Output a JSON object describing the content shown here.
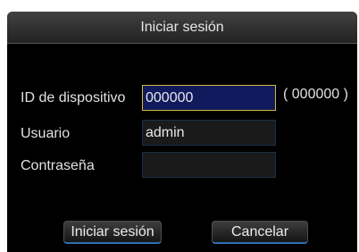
{
  "dialog": {
    "title": "Iniciar sesión",
    "device_id": {
      "label": "ID de dispositivo",
      "value": "000000",
      "hint": "( 000000 )"
    },
    "username": {
      "label": "Usuario",
      "value": "admin"
    },
    "password": {
      "label": "Contraseña",
      "value": ""
    },
    "buttons": {
      "login": "Iniciar sesión",
      "cancel": "Cancelar"
    }
  },
  "colors": {
    "focused_field_bg": "#111a5c",
    "focused_field_border": "#d4b53a",
    "button_underline": "#2f6fb4"
  }
}
